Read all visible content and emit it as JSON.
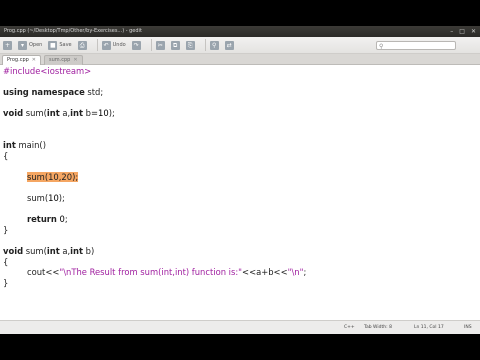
{
  "window": {
    "title": "Prog.cpp (~/Desktop/Tmp/Other/by-Exercises...) - gedit"
  },
  "toolbar": {
    "items": [
      {
        "label": "",
        "icon": "new-icon"
      },
      {
        "label": "Open",
        "icon": "open-icon"
      },
      {
        "label": "Save",
        "icon": "save-icon"
      },
      {
        "label": "",
        "icon": "print-icon"
      },
      {
        "label": "Undo",
        "icon": "undo-icon"
      },
      {
        "label": "",
        "icon": "redo-icon"
      },
      {
        "label": "",
        "icon": "cut-icon"
      },
      {
        "label": "",
        "icon": "copy-icon"
      },
      {
        "label": "",
        "icon": "paste-icon"
      },
      {
        "label": "",
        "icon": "find-icon"
      },
      {
        "label": "",
        "icon": "replace-icon"
      }
    ]
  },
  "tabs": [
    {
      "label": "Prog.cpp",
      "active": true
    },
    {
      "label": "sum.cpp",
      "active": false
    }
  ],
  "code": {
    "l1": "#include<iostream>",
    "l3_kw1": "using",
    "l3_kw2": "namespace",
    "l3_rest": " std;",
    "l5_kw": "void",
    "l5_mid": " sum(",
    "l5_int1": "int",
    "l5_a": " a,",
    "l5_int2": "int",
    "l5_b": " b=",
    "l5_num": "10",
    "l5_end": ");",
    "l8_kw": "int",
    "l8_rest": " main()",
    "l9": "{",
    "l11_sel": "sum(10,20);",
    "l13_a": "sum(",
    "l13_num": "10",
    "l13_end": ");",
    "l15_kw": "return",
    "l15_num": " 0",
    "l15_end": ";",
    "l16": "}",
    "l18_kw": "void",
    "l18_mid": " sum(",
    "l18_int1": "int",
    "l18_a": " a,",
    "l18_int2": "int",
    "l18_b": " b)",
    "l19": "{",
    "l20_a": "cout<<",
    "l20_str": "\"\\nThe Result from sum(int,int) function is:\"",
    "l20_end": "<<a+b<<",
    "l20_str2": "\"\\n\"",
    "l20_semi": ";",
    "l21": "}"
  },
  "status": {
    "language": "C++",
    "tab_width": "Tab Width: 8",
    "position": "Ln 11, Col 17",
    "mode": "INS"
  }
}
